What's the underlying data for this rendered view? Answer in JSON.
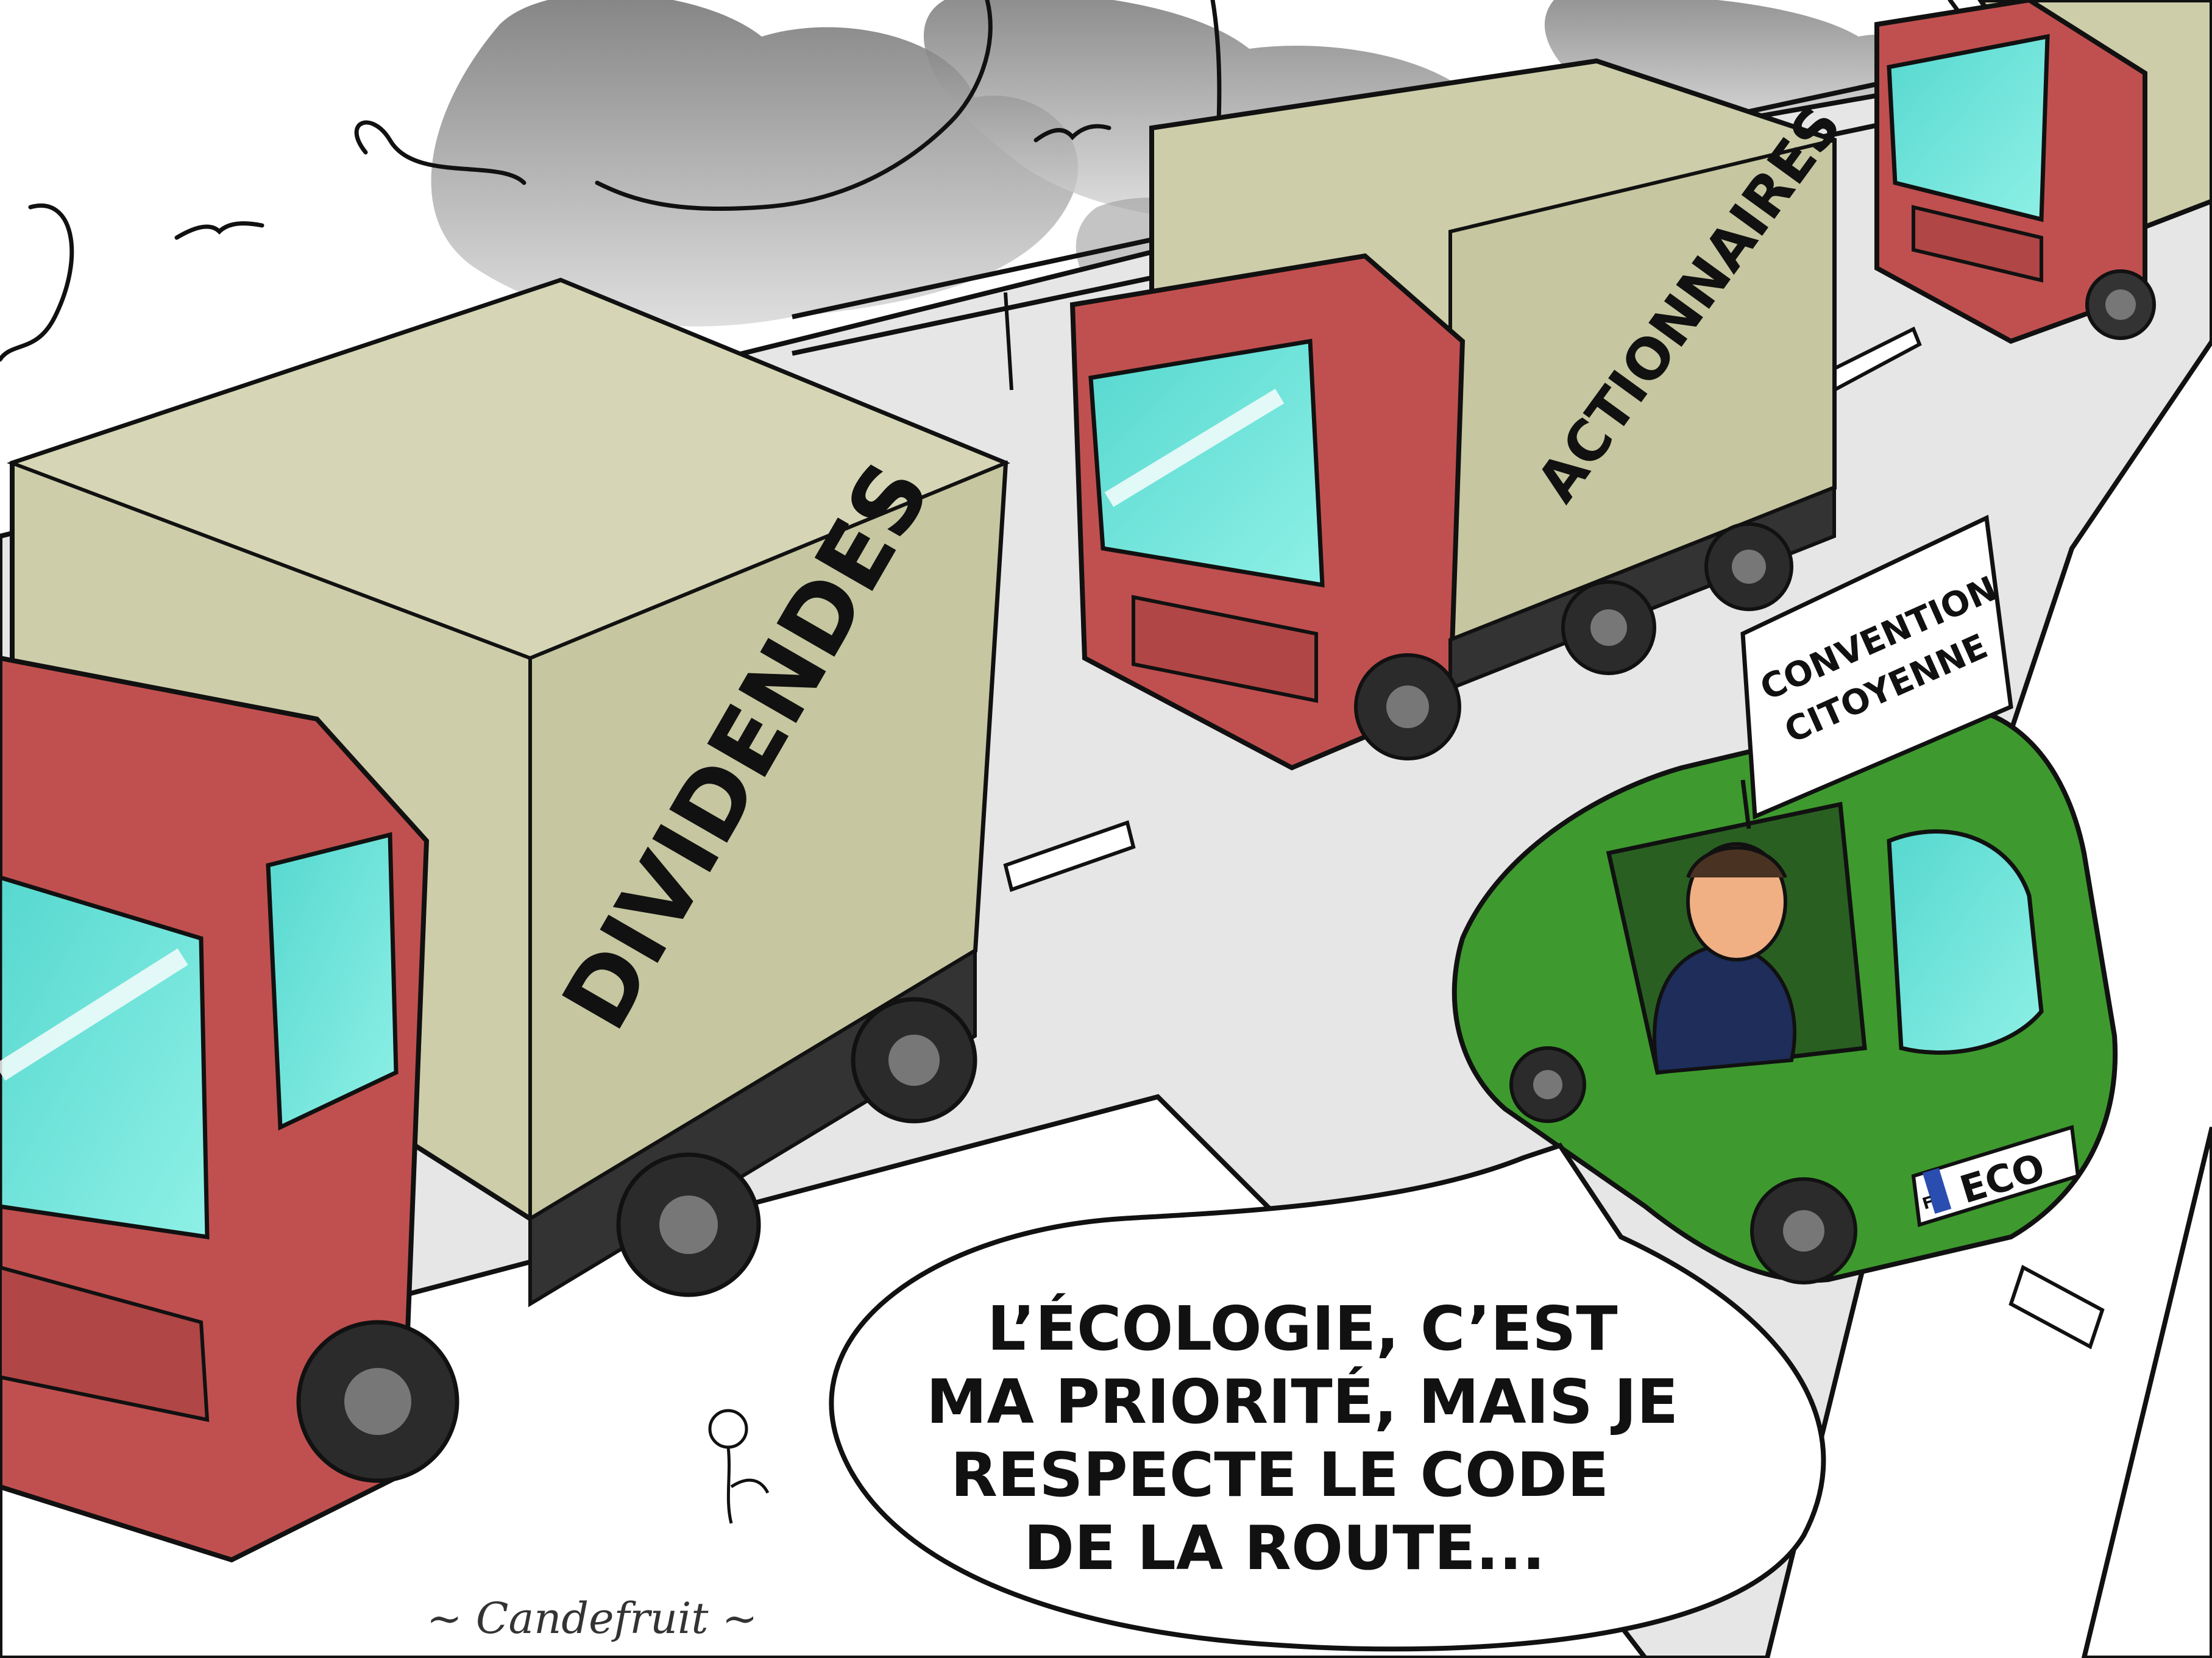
{
  "truck_labels": {
    "front": "DIVIDENDES",
    "middle": "ACTIONNAIRES"
  },
  "sign": {
    "line1": "CONVENTION",
    "line2": "CITOYENNE"
  },
  "plate": {
    "country": "F",
    "text": "ECO"
  },
  "speech": {
    "line1": "L’ÉCOLOGIE, C’EST",
    "line2": "MA PRIORITÉ, MAIS JE",
    "line3": "RESPECTE LE CODE",
    "line4": "DE LA ROUTE..."
  },
  "signature": "~ Candefruit ~",
  "colors": {
    "truck_cab": "#c0504f",
    "truck_box": "#cdcdaa",
    "windshield": "#62e0d6",
    "car": "#3e9a2e",
    "road": "#e6e6e6",
    "smoke": "#8a8a8a",
    "sky": "#ffffff"
  }
}
